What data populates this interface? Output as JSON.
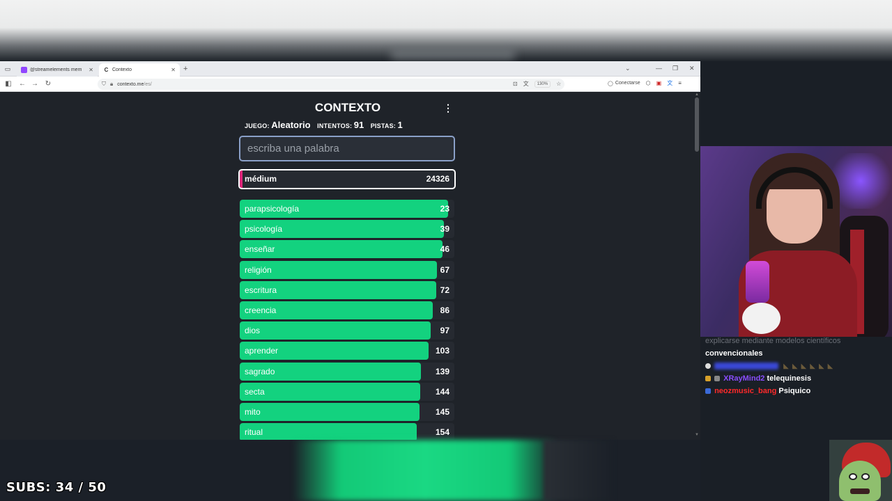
{
  "browser": {
    "tabs": [
      {
        "title": "@streamelements mem",
        "favicon_color": "#9146ff"
      },
      {
        "title": "Contexto",
        "favicon_color": "#333333"
      }
    ],
    "new_tab": "+",
    "url_main": "contexto.me",
    "url_path": "/es/",
    "zoom": "130%",
    "connect_label": "Conectarse"
  },
  "game": {
    "title": "CONTEXTO",
    "stats": {
      "game_label": "JUEGO:",
      "game_value": "Aleatorio",
      "attempts_label": "INTENTOS:",
      "attempts_value": "91",
      "hints_label": "PISTAS:",
      "hints_value": "1"
    },
    "input_placeholder": "escriba una palabra",
    "last_guess": {
      "word": "médium",
      "rank": "24326"
    },
    "guesses": [
      {
        "word": "parapsicología",
        "rank": "23",
        "fill": 0.97
      },
      {
        "word": "psicología",
        "rank": "39",
        "fill": 0.95
      },
      {
        "word": "enseñar",
        "rank": "46",
        "fill": 0.945
      },
      {
        "word": "religión",
        "rank": "67",
        "fill": 0.92
      },
      {
        "word": "escritura",
        "rank": "72",
        "fill": 0.915
      },
      {
        "word": "creencia",
        "rank": "86",
        "fill": 0.9
      },
      {
        "word": "dios",
        "rank": "97",
        "fill": 0.89
      },
      {
        "word": "aprender",
        "rank": "103",
        "fill": 0.88
      },
      {
        "word": "sagrado",
        "rank": "139",
        "fill": 0.845
      },
      {
        "word": "secta",
        "rank": "144",
        "fill": 0.84
      },
      {
        "word": "mito",
        "rank": "145",
        "fill": 0.838
      },
      {
        "word": "ritual",
        "rank": "154",
        "fill": 0.825
      }
    ]
  },
  "chat": {
    "faded_line": "explicarse mediante modelos científicos",
    "continuation": "convencionales",
    "messages": [
      {
        "user": "XRayMind2",
        "user_color": "#8a4dff",
        "text": "telequinesis"
      },
      {
        "user": "neozmusic_bang",
        "user_color": "#ff2a2a",
        "text": "Psiquico"
      }
    ]
  },
  "overlay": {
    "subs": "SUBS: 34 / 50"
  }
}
